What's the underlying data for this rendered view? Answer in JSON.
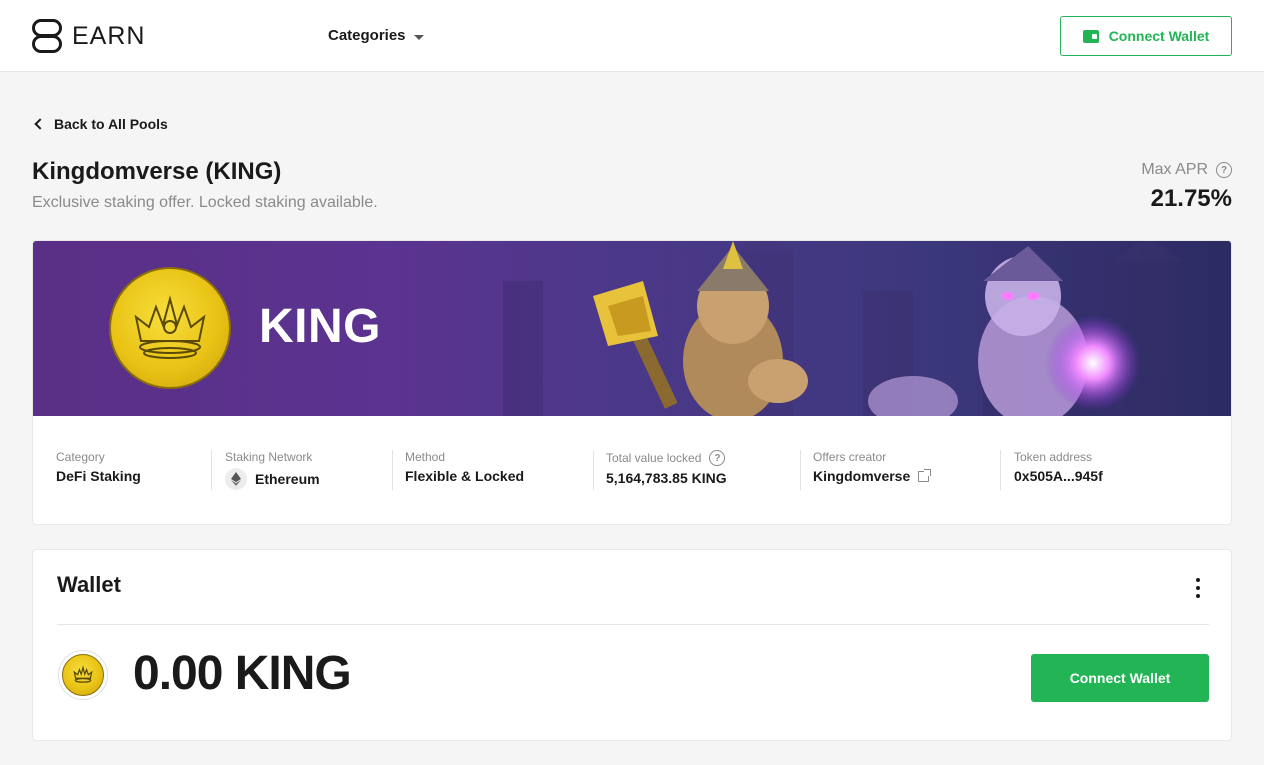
{
  "header": {
    "logo_text": "EARN",
    "categories_label": "Categories",
    "connect_wallet_label": "Connect Wallet"
  },
  "pool": {
    "back_label": "Back to All Pools",
    "title": "Kingdomverse (KING)",
    "subtitle": "Exclusive staking offer. Locked staking available.",
    "max_apr_label": "Max APR",
    "max_apr_value": "21.75%",
    "banner_ticker": "KING",
    "info": {
      "category_label": "Category",
      "category_value": "DeFi Staking",
      "network_label": "Staking Network",
      "network_value": "Ethereum",
      "method_label": "Method",
      "method_value": "Flexible & Locked",
      "tvl_label": "Total value locked",
      "tvl_value": "5,164,783.85 KING",
      "creator_label": "Offers creator",
      "creator_value": "Kingdomverse",
      "token_label": "Token address",
      "token_value": "0x505A...945f"
    }
  },
  "wallet": {
    "title": "Wallet",
    "balance": "0.00 KING",
    "connect_label": "Connect Wallet"
  },
  "colors": {
    "accent_green": "#22b455",
    "banner_purple": "#5a2f86",
    "coin_gold": "#e9c315"
  }
}
